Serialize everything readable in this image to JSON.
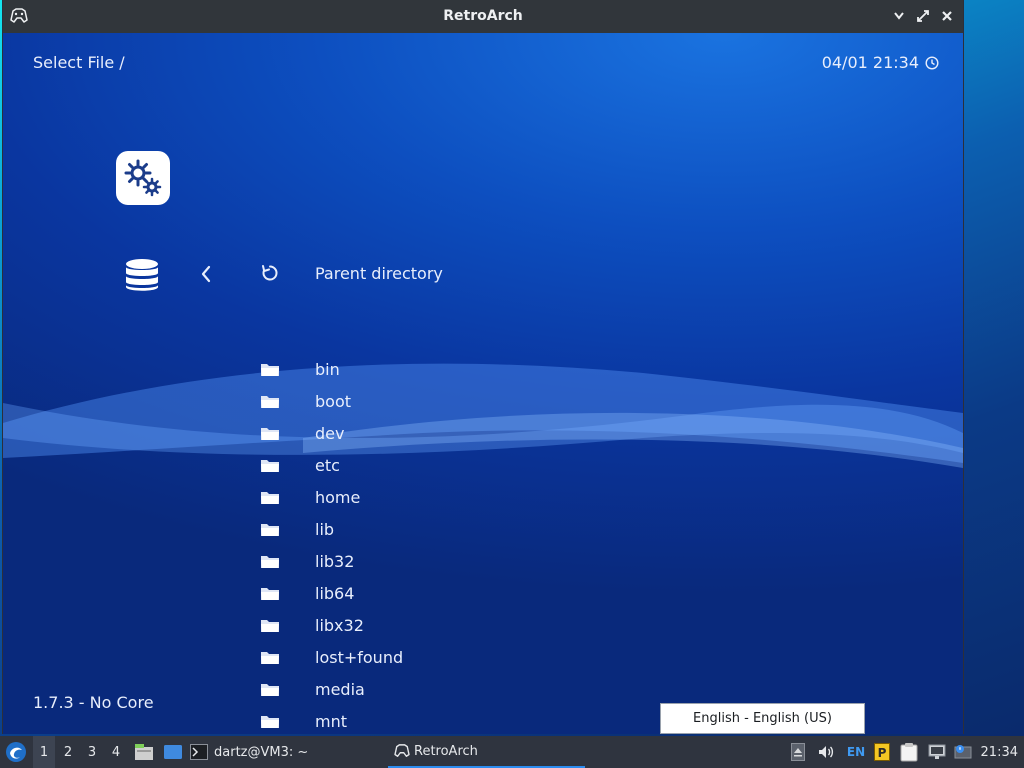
{
  "window": {
    "title": "RetroArch"
  },
  "header": {
    "path_label": "Select File /",
    "datetime": "04/01 21:34"
  },
  "footer": {
    "version": "1.7.3 - No Core"
  },
  "parent_entry": {
    "label": "Parent directory"
  },
  "entries": [
    {
      "label": "bin"
    },
    {
      "label": "boot"
    },
    {
      "label": "dev"
    },
    {
      "label": "etc"
    },
    {
      "label": "home"
    },
    {
      "label": "lib"
    },
    {
      "label": "lib32"
    },
    {
      "label": "lib64"
    },
    {
      "label": "libx32"
    },
    {
      "label": "lost+found"
    },
    {
      "label": "media"
    },
    {
      "label": "mnt"
    }
  ],
  "language_popup": {
    "text": "English - English (US)"
  },
  "taskbar": {
    "workspaces": [
      "1",
      "2",
      "3",
      "4"
    ],
    "terminal_label": "dartz@VM3: ~",
    "retroarch_label": "RetroArch",
    "keyboard_layout": "EN",
    "clock": "21:34"
  },
  "colors": {
    "accent_blue": "#0d4fc0",
    "taskbar_bg": "#2f343f",
    "titlebar_bg": "#31363b"
  }
}
